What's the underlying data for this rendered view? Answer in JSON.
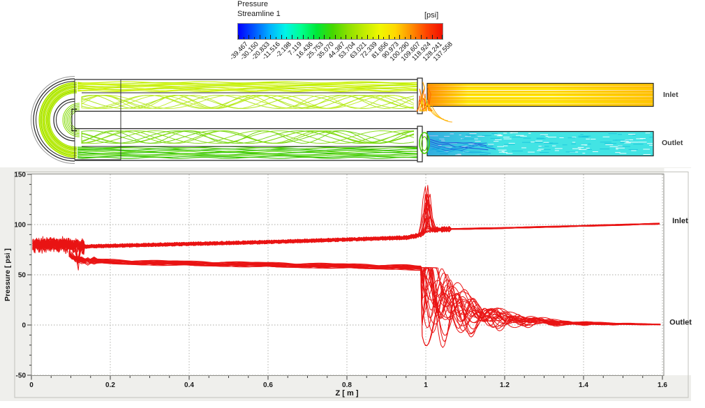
{
  "legend": {
    "title": "Pressure",
    "subtitle": "Streamline 1",
    "units": "[psi]",
    "tick_values": [
      "-39.467",
      "-30.150",
      "-20.833",
      "-11.516",
      "-2.198",
      "7.119",
      "16.436",
      "25.753",
      "35.070",
      "44.387",
      "53.704",
      "63.021",
      "72.339",
      "81.656",
      "90.973",
      "100.290",
      "109.607",
      "118.924",
      "128.241",
      "137.558"
    ],
    "colormap": [
      "#0000fe",
      "#0055ff",
      "#00b0ff",
      "#00f4e8",
      "#00ff90",
      "#00e838",
      "#45d800",
      "#8ce000",
      "#c0ec00",
      "#f0f800",
      "#ffd800",
      "#ff9000",
      "#ff4200",
      "#f01000"
    ]
  },
  "geometry": {
    "inlet_label": "Inlet",
    "outlet_label": "Outlet",
    "outline_color": "#222222",
    "box_color": "#333333",
    "bend_streamline_colors": [
      "#a8e400",
      "#bfee00",
      "#93dd00",
      "#cdf400"
    ],
    "tight_bend_colors": [
      "#76d600",
      "#8ade00"
    ],
    "top_band_colors": [
      "#c8f000",
      "#b6ea00",
      "#d8f818"
    ],
    "top_weave_colors": [
      "#bcec1e",
      "#a9e30c"
    ],
    "bottom_weave_colors": [
      "#84dc10",
      "#68d300"
    ],
    "bottom_band_colors": [
      "#3fca00",
      "#56d300",
      "#2fc200"
    ],
    "junction_colors": [
      "#ff3c00",
      "#ff7300",
      "#ffa500",
      "#ffd000"
    ],
    "loop_color": "#46cc00",
    "inlet_pipe": {
      "fill": "#ffe300",
      "hot_color": "#ff8800",
      "gold_color": "#ffaa00",
      "stripe_colors": [
        "#ffd000",
        "#fff9a0",
        "#ffc400",
        "#ffee00",
        "#ffffff"
      ]
    },
    "outlet_pipe": {
      "fill": "#42e4e4",
      "speckle_colors": [
        "#ffffff",
        "#16c2dc"
      ],
      "swirl_colors": [
        "#1d43d8",
        "#1b6ae0",
        "#13a8e0"
      ],
      "shade_color": "#1b55d8"
    }
  },
  "chart_data": {
    "type": "line",
    "title": "",
    "xlabel": "Z [ m ]",
    "ylabel": "Pressure [ psi ]",
    "xlim": [
      0,
      1.605
    ],
    "ylim": [
      -50,
      150
    ],
    "x_ticks": [
      0,
      0.2,
      0.4,
      0.6,
      0.8,
      1,
      1.2,
      1.4,
      1.6
    ],
    "x_tick_labels": [
      "0",
      "0.2",
      "0.4",
      "0.6",
      "0.8",
      "1",
      "1.2",
      "1.4",
      "1.6"
    ],
    "y_ticks": [
      150,
      100,
      50,
      0,
      -50
    ],
    "y_tick_labels": [
      "150",
      "100",
      "50",
      "0",
      "-50"
    ],
    "x_minor_step": 0.05,
    "y_minor_step": 10,
    "grid": "dotted",
    "legend_position": "none",
    "line_color": "#e80000",
    "panel_color": "#efefec",
    "plot_background": "#ffffff",
    "series": [
      {
        "name": "inlet-streamlines",
        "label": "Inlet",
        "n_lines": 22,
        "base_path": [
          [
            0.003,
            80
          ],
          [
            0.05,
            80.5
          ],
          [
            0.09,
            80
          ],
          [
            0.12,
            79
          ],
          [
            0.135,
            78.2
          ],
          [
            0.3,
            79.8
          ],
          [
            0.6,
            82.6
          ],
          [
            0.95,
            87
          ],
          [
            0.985,
            89.5
          ],
          [
            1.005,
            94.5
          ],
          [
            1.05,
            95.4
          ],
          [
            1.2,
            96.6
          ],
          [
            1.4,
            98.7
          ],
          [
            1.597,
            100.9
          ]
        ],
        "bend_zone": [
          0,
          0.135
        ],
        "bend_noise": 3.5,
        "band_noise": 1.1,
        "spike": {
          "z_center": 1.0,
          "peak_min": 90,
          "peak_max": 138,
          "width": 0.006
        },
        "dip": {
          "z": 0.118,
          "depth_max": 27
        }
      },
      {
        "name": "outlet-streamlines",
        "label": "Outlet",
        "n_lines": 24,
        "base_path": [
          [
            0.095,
            71
          ],
          [
            0.11,
            66
          ],
          [
            0.135,
            63.8
          ],
          [
            0.3,
            62
          ],
          [
            0.6,
            60
          ],
          [
            0.95,
            57.6
          ],
          [
            0.985,
            56.5
          ]
        ],
        "decay_path": [
          [
            0.99,
            44
          ],
          [
            1.03,
            27
          ],
          [
            1.1,
            13
          ],
          [
            1.2,
            6
          ],
          [
            1.35,
            2
          ],
          [
            1.597,
            0.5
          ]
        ],
        "band_noise": 1.2,
        "osc": {
          "amp_min": 8,
          "amp_max": 55,
          "wavelength_min": 0.05,
          "wavelength_max": 0.12,
          "tau_min": 0.06,
          "tau_max": 0.13
        },
        "clamp": [
          -37,
          57
        ]
      }
    ],
    "annotations": [
      {
        "text": "Inlet",
        "x": 1.625,
        "y": 104
      },
      {
        "text": "Outlet",
        "x": 1.618,
        "y": 3
      }
    ]
  }
}
